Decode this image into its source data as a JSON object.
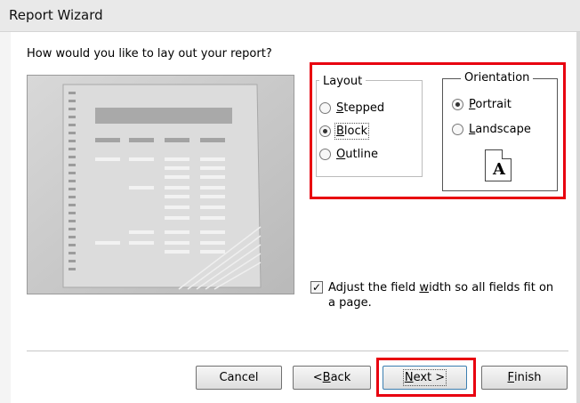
{
  "window": {
    "title": "Report Wizard"
  },
  "question": "How would you like to lay out your report?",
  "layout": {
    "legend": "Layout",
    "options": [
      {
        "pre": "",
        "key": "S",
        "post": "tepped",
        "selected": false
      },
      {
        "pre": "",
        "key": "B",
        "post": "lock",
        "selected": true
      },
      {
        "pre": "",
        "key": "O",
        "post": "utline",
        "selected": false
      }
    ]
  },
  "orientation": {
    "legend": "Orientation",
    "options": [
      {
        "pre": "",
        "key": "P",
        "post": "ortrait",
        "selected": true
      },
      {
        "pre": "",
        "key": "L",
        "post": "andscape",
        "selected": false
      }
    ],
    "icon_letter": "A"
  },
  "adjust_width": {
    "checked": true,
    "pre": "Adjust the field ",
    "key": "w",
    "post": "idth so all fields fit on",
    "line2": "a page."
  },
  "buttons": {
    "cancel": {
      "label": "Cancel"
    },
    "back": {
      "pre": "< ",
      "key": "B",
      "post": "ack"
    },
    "next": {
      "pre": "",
      "key": "N",
      "post": "ext >"
    },
    "finish": {
      "pre": "",
      "key": "F",
      "post": "inish"
    }
  },
  "colors": {
    "highlight": "#e8000f",
    "preview_bg": "#c7c7c7"
  }
}
